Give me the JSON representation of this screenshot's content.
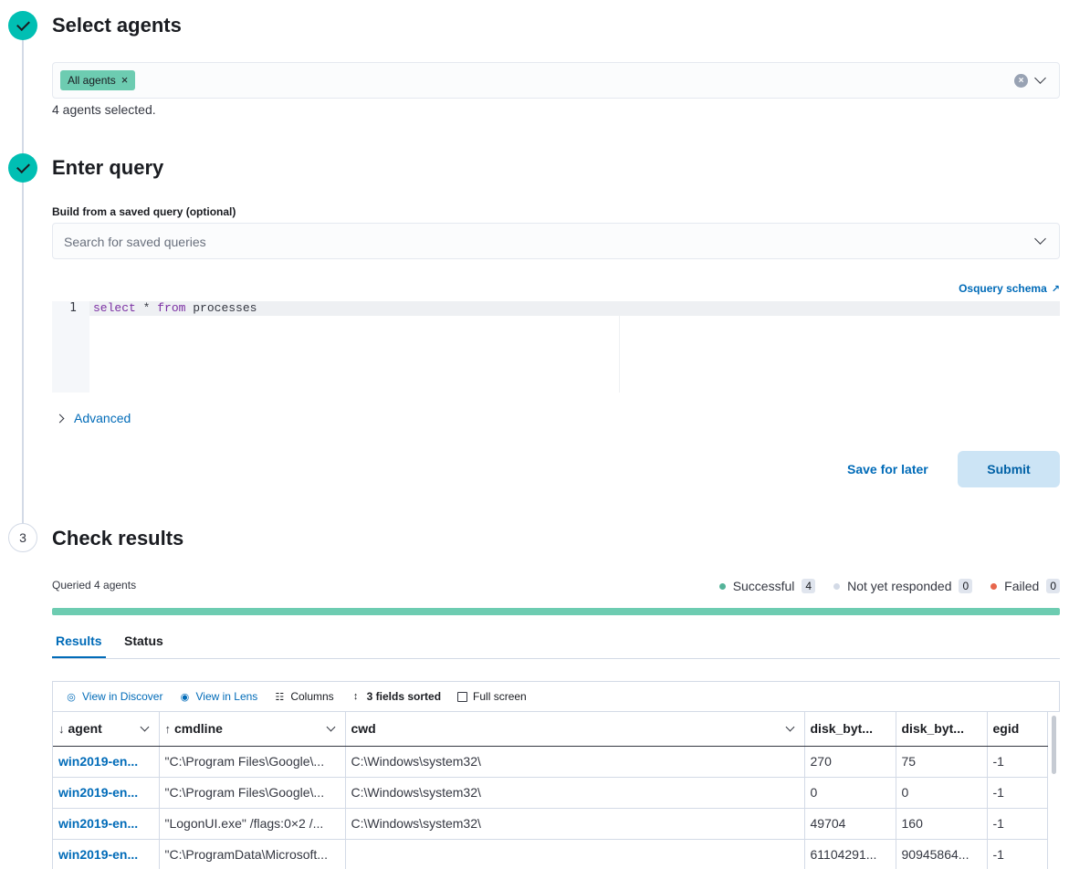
{
  "steps": {
    "select_agents": {
      "title": "Select agents"
    },
    "enter_query": {
      "title": "Enter query"
    },
    "check_results": {
      "number": "3",
      "title": "Check results"
    }
  },
  "agents": {
    "pill_label": "All agents",
    "selected_text": "4 agents selected."
  },
  "query": {
    "saved_label": "Build from a saved query (optional)",
    "saved_placeholder": "Search for saved queries",
    "schema_link": "Osquery schema",
    "line_number": "1",
    "code_kw1": "select",
    "code_mid": " * ",
    "code_kw2": "from",
    "code_rest": " processes",
    "advanced_label": "Advanced",
    "save_for_later": "Save for later",
    "submit": "Submit"
  },
  "results": {
    "queried_text": "Queried 4 agents",
    "progress_fraction": 1.0,
    "status": [
      {
        "label": "Successful",
        "count": "4",
        "color": "#54b399"
      },
      {
        "label": "Not yet responded",
        "count": "0",
        "color": "#d3dae6"
      },
      {
        "label": "Failed",
        "count": "0",
        "color": "#e7664c"
      }
    ],
    "tabs": [
      "Results",
      "Status"
    ],
    "toolbar": {
      "discover": "View in Discover",
      "lens": "View in Lens",
      "columns": "Columns",
      "sorted": "3 fields sorted",
      "fullscreen": "Full screen"
    },
    "columns": [
      "agent",
      "cmdline",
      "cwd",
      "disk_byt...",
      "disk_byt...",
      "egid"
    ],
    "rows": [
      [
        "win2019-en...",
        "\"C:\\Program Files\\Google\\...",
        "C:\\Windows\\system32\\",
        "270",
        "75",
        "-1"
      ],
      [
        "win2019-en...",
        "\"C:\\Program Files\\Google\\...",
        "C:\\Windows\\system32\\",
        "0",
        "0",
        "-1"
      ],
      [
        "win2019-en...",
        "\"LogonUI.exe\" /flags:0×2 /...",
        "C:\\Windows\\system32\\",
        "49704",
        "160",
        "-1"
      ],
      [
        "win2019-en...",
        "\"C:\\ProgramData\\Microsoft...",
        "",
        "61104291...",
        "90945864...",
        "-1"
      ]
    ]
  }
}
